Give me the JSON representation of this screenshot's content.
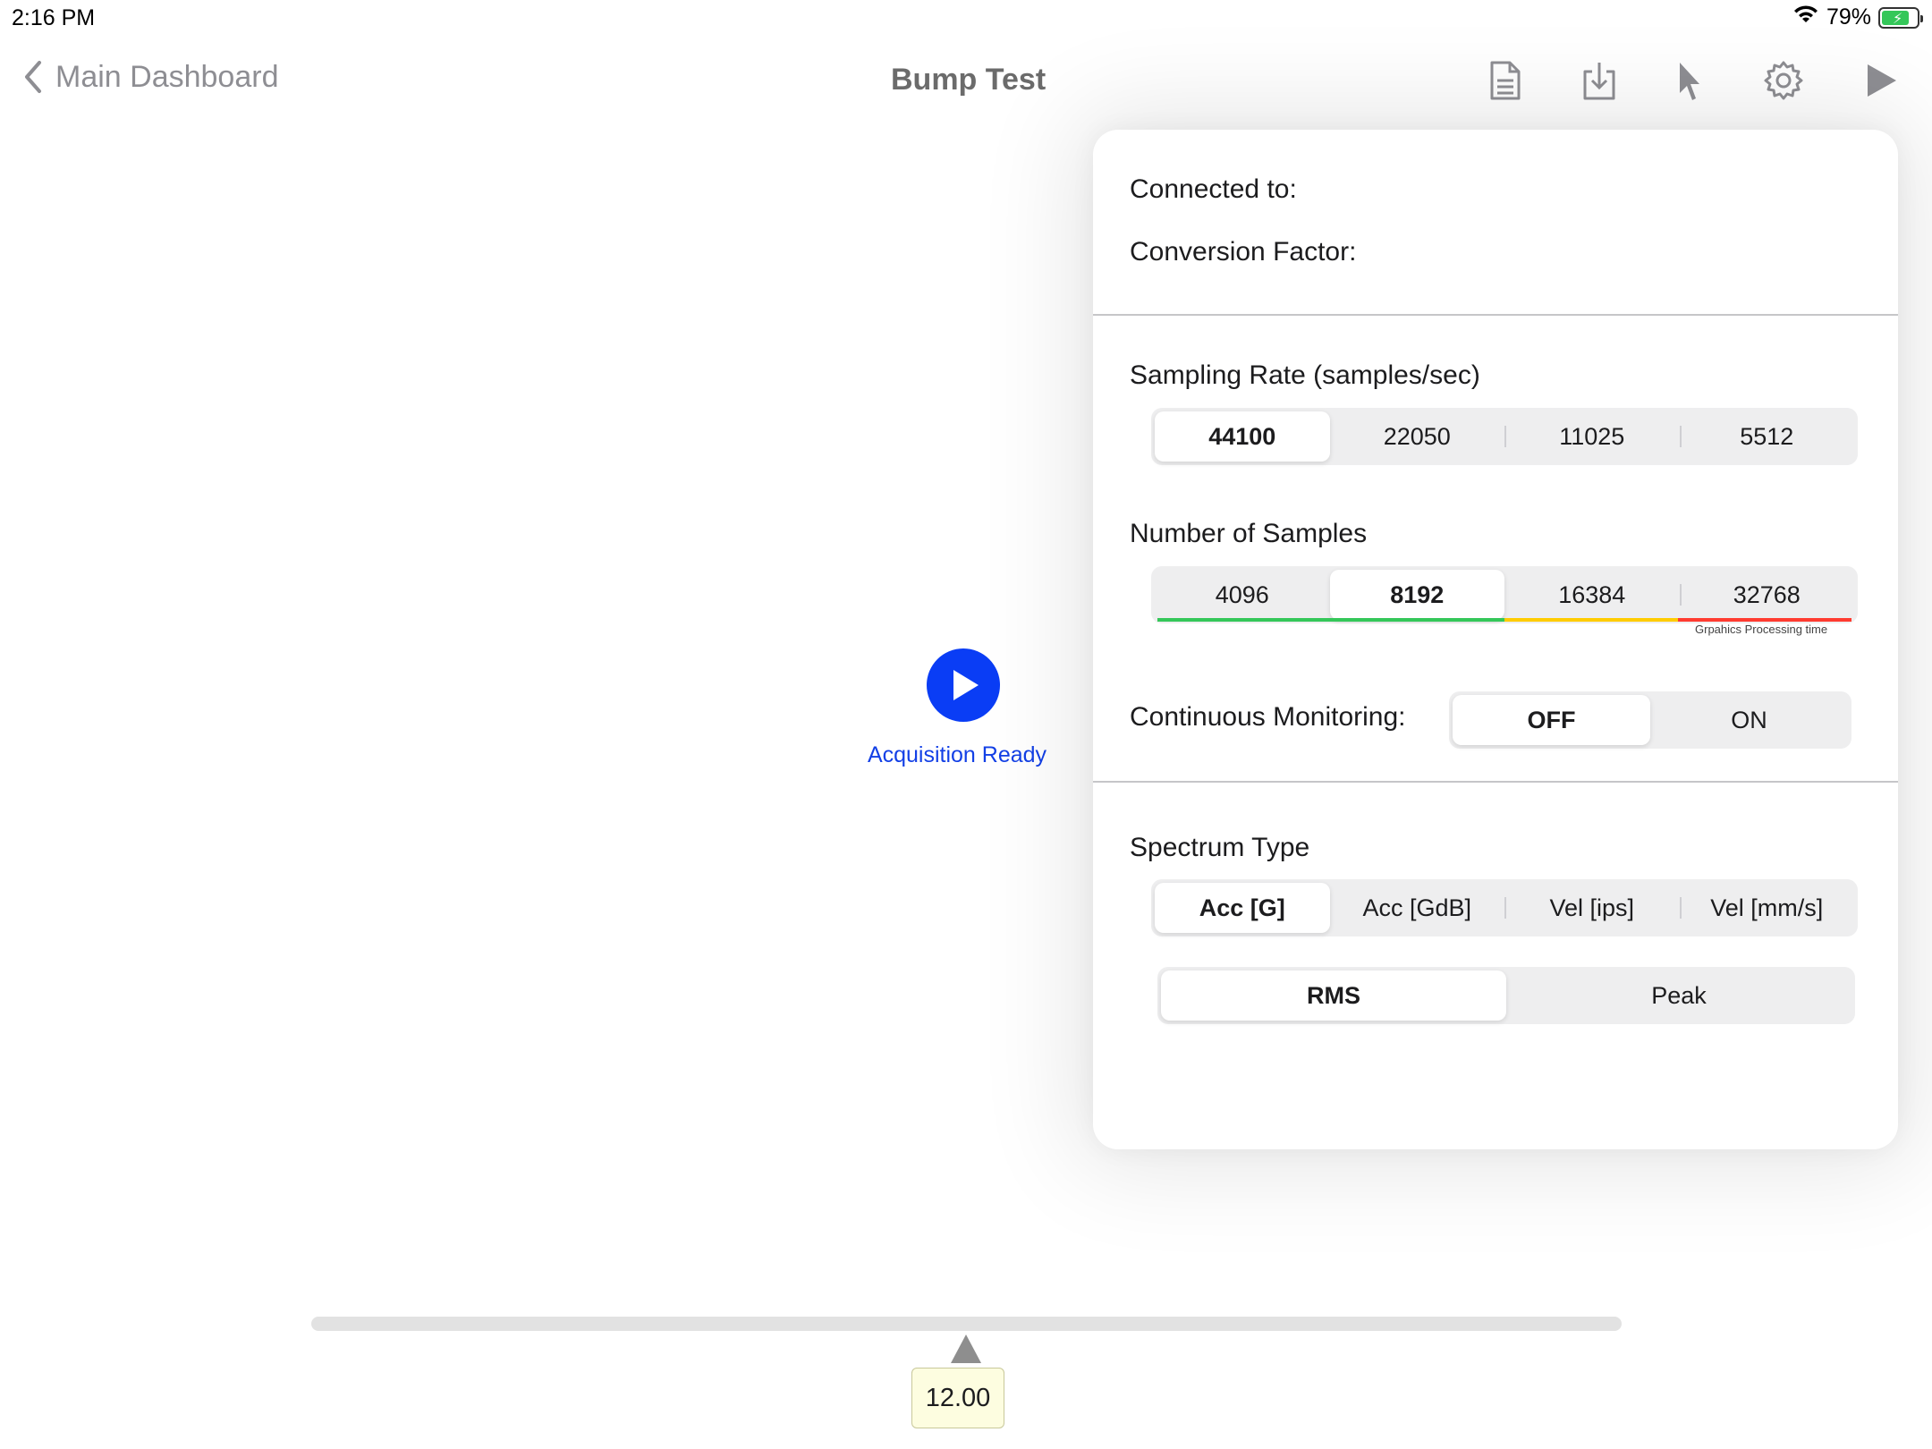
{
  "status_bar": {
    "time": "2:16 PM",
    "battery_percent": "79%",
    "battery_level": 0.79
  },
  "nav": {
    "back_label": "Main Dashboard",
    "title": "Bump Test",
    "icons": [
      "document-icon",
      "download-icon",
      "cursor-icon",
      "gear-icon",
      "play-icon"
    ]
  },
  "acquisition": {
    "status": "Acquisition Ready"
  },
  "slider": {
    "value": "12.00"
  },
  "settings": {
    "connected_to_label": "Connected to:",
    "conversion_factor_label": "Conversion Factor:",
    "sampling_rate": {
      "label": "Sampling Rate (samples/sec)",
      "options": [
        "44100",
        "22050",
        "11025",
        "5512"
      ],
      "selected": 0
    },
    "num_samples": {
      "label": "Number of Samples",
      "options": [
        "4096",
        "8192",
        "16384",
        "32768"
      ],
      "selected": 1,
      "time_caption": "Grpahics Processing time",
      "time_colors": [
        "#34c759",
        "#34c759",
        "#ffcc00",
        "#ff3b30"
      ]
    },
    "continuous_monitoring": {
      "label": "Continuous Monitoring:",
      "options": [
        "OFF",
        "ON"
      ],
      "selected": 0
    },
    "spectrum_type": {
      "label": "Spectrum Type",
      "options": [
        "Acc [G]",
        "Acc [GdB]",
        "Vel [ips]",
        "Vel [mm/s]"
      ],
      "selected": 0
    },
    "measure_mode": {
      "options": [
        "RMS",
        "Peak"
      ],
      "selected": 0
    }
  }
}
